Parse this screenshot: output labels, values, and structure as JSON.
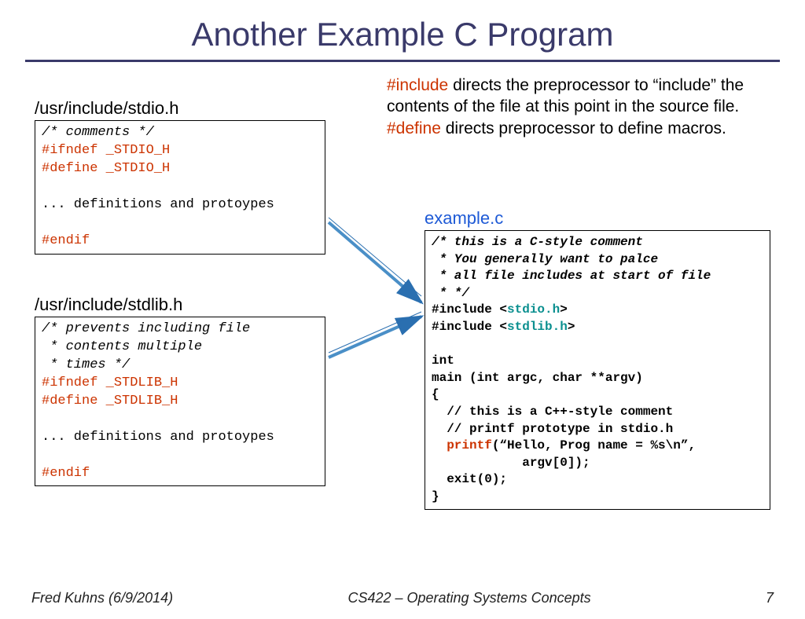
{
  "title": "Another Example C Program",
  "stdio": {
    "label": "/usr/include/stdio.h",
    "l1": "/* comments */",
    "l2": "#ifndef _STDIO_H",
    "l3": "#define _STDIO_H",
    "l4": "...",
    "l4b": " definitions and protoypes",
    "l5": "#endif"
  },
  "stdlib": {
    "label": "/usr/include/stdlib.h",
    "l1": "/* prevents including file",
    "l2": " * contents multiple",
    "l3": " * times */",
    "l4": "#ifndef _STDLIB_H",
    "l5": "#define _STDLIB_H",
    "l6": "...",
    "l6b": " definitions and protoypes",
    "l7": "#endif"
  },
  "desc": {
    "kw1": "#include",
    "t1": " directs the preprocessor to “include” the contents of the file at this point in the source file.",
    "kw2": "#define",
    "t2": " directs preprocessor to define macros."
  },
  "example": {
    "label": "example.c",
    "c1": "/* this is a C-style comment",
    "c2": " * You generally want to palce",
    "c3": " * all file includes at start of file",
    "c4": " * */",
    "inc1a": "#include <",
    "inc1b": "stdio.h",
    "inc1c": ">",
    "inc2a": "#include <",
    "inc2b": "stdlib.h",
    "inc2c": ">",
    "m1": "int",
    "m2": "main (int argc, char **argv)",
    "m3": "{",
    "m4": "  // this is a C++-style comment",
    "m5": "  // printf prototype in stdio.h",
    "pf1": "  ",
    "pf2": "printf",
    "pf3": "(“Hello, Prog name = %s\\n”,",
    "pf4": "            argv[0]);",
    "m6": "  exit(0);",
    "m7": "}"
  },
  "footer": {
    "left": "Fred Kuhns (6/9/2014)",
    "center": "CS422 – Operating Systems Concepts",
    "right": "7"
  }
}
